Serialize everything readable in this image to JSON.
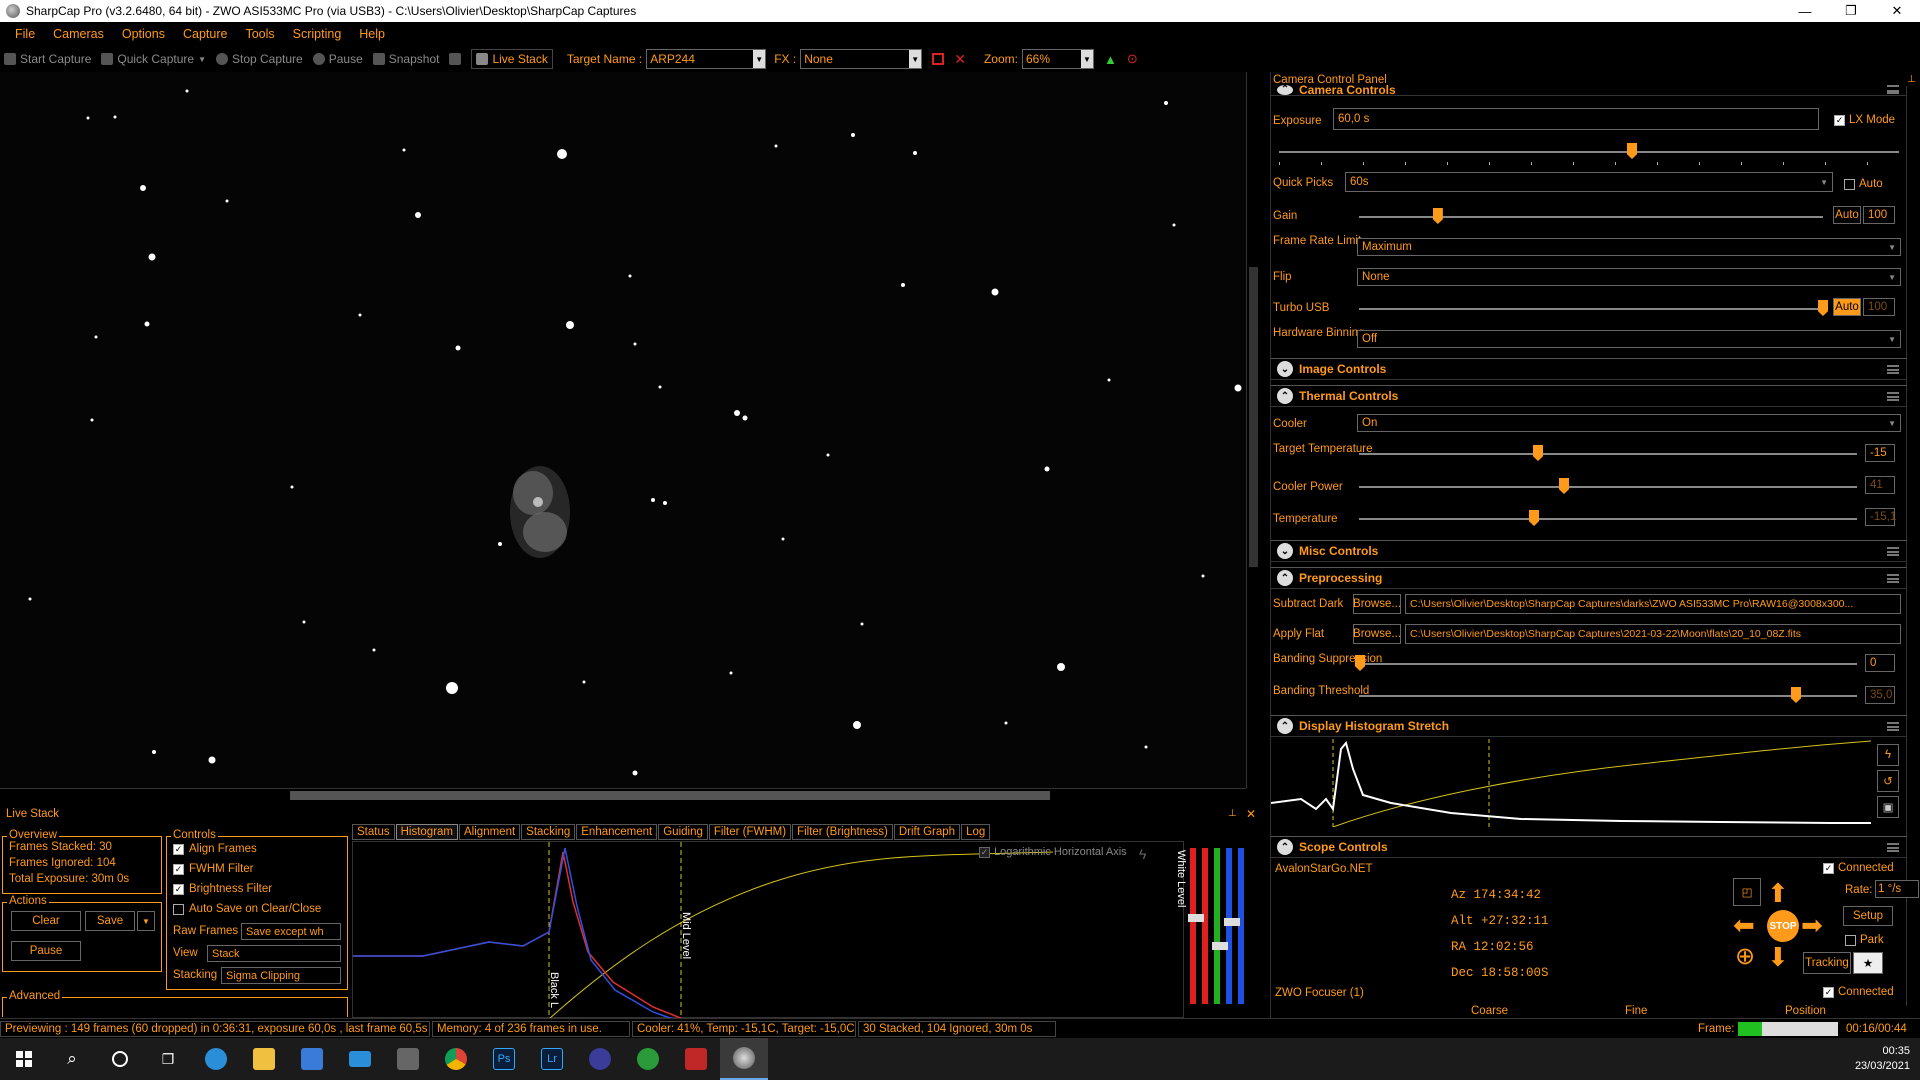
{
  "window": {
    "title": "SharpCap Pro (v3.2.6480, 64 bit) - ZWO ASI533MC Pro (via USB3) - C:\\Users\\Olivier\\Desktop\\SharpCap Captures",
    "minimize": "—",
    "maximize": "❐",
    "close": "✕"
  },
  "menu": [
    "File",
    "Cameras",
    "Options",
    "Capture",
    "Tools",
    "Scripting",
    "Help"
  ],
  "toolbar": {
    "start_capture": "Start Capture",
    "quick_capture": "Quick Capture",
    "stop_capture": "Stop Capture",
    "pause": "Pause",
    "snapshot": "Snapshot",
    "live_stack": "Live Stack",
    "target_label": "Target Name :",
    "target_value": "ARP244",
    "fx_label": "FX :",
    "fx_value": "None",
    "zoom_label": "Zoom:",
    "zoom_value": "66%"
  },
  "ccp": {
    "title": "Camera Control Panel",
    "camera_controls": "Camera Controls",
    "exposure_label": "Exposure",
    "exposure_value": "60,0 s",
    "lx_mode": "LX Mode",
    "quick_picks_label": "Quick Picks",
    "quick_picks_value": "60s",
    "auto": "Auto",
    "gain_label": "Gain",
    "gain_value": "100",
    "gain_level": 0.17,
    "frame_rate_label": "Frame Rate Limit",
    "frame_rate_value": "Maximum",
    "flip_label": "Flip",
    "flip_value": "None",
    "turbo_label": "Turbo USB",
    "turbo_value": "100",
    "turbo_level": 1.0,
    "binning_label": "Hardware Binning",
    "binning_value": "Off",
    "image_controls": "Image Controls",
    "thermal_controls": "Thermal Controls",
    "cooler_label": "Cooler",
    "cooler_value": "On",
    "target_temp_label": "Target Temperature",
    "target_temp_value": "-15",
    "cooler_power_label": "Cooler Power",
    "cooler_power_value": "41",
    "temperature_label": "Temperature",
    "temperature_value": "-15,1",
    "misc_controls": "Misc Controls",
    "preprocessing": "Preprocessing",
    "subtract_dark_label": "Subtract Dark",
    "browse": "Browse...",
    "subtract_dark_value": "C:\\Users\\Olivier\\Desktop\\SharpCap Captures\\darks\\ZWO ASI533MC Pro\\RAW16@3008x300...",
    "apply_flat_label": "Apply Flat",
    "apply_flat_value": "C:\\Users\\Olivier\\Desktop\\SharpCap Captures\\2021-03-22\\Moon\\flats\\20_10_08Z.fits",
    "banding_supp_label": "Banding Suppression",
    "banding_supp_value": "0",
    "banding_thr_label": "Banding Threshold",
    "banding_thr_value": "35,0",
    "histogram_stretch": "Display Histogram Stretch",
    "scope_controls": "Scope Controls",
    "connected": "Connected",
    "scope_name": "AvalonStarGo.NET",
    "az": "Az  174:34:42",
    "alt": "Alt +27:32:11",
    "ra": "RA  12:02:56",
    "dec": "Dec 18:58:00S",
    "rate_label": "Rate:",
    "rate_value": "1 °/s",
    "setup": "Setup",
    "park": "Park",
    "stop": "STOP",
    "tracking": "Tracking",
    "focuser_name": "ZWO Focuser (1)",
    "coarse": "Coarse",
    "fine": "Fine",
    "position": "Position"
  },
  "live_stack": {
    "title": "Live Stack",
    "overview": "Overview",
    "frames_stacked": "Frames Stacked:  30",
    "frames_ignored": "Frames Ignored:   104",
    "total_exposure": "Total Exposure:   30m 0s",
    "actions": "Actions",
    "clear": "Clear",
    "save": "Save",
    "pause": "Pause",
    "advanced": "Advanced",
    "controls": "Controls",
    "align_frames": "Align Frames",
    "fwhm_filter": "FWHM Filter",
    "brightness_filter": "Brightness Filter",
    "auto_save": "Auto Save on Clear/Close",
    "raw_frames_label": "Raw Frames",
    "raw_frames_value": "Save except wh",
    "view_label": "View",
    "view_value": "Stack",
    "stacking_label": "Stacking",
    "stacking_value": "Sigma Clipping",
    "tabs": [
      "Status",
      "Histogram",
      "Alignment",
      "Stacking",
      "Enhancement",
      "Guiding",
      "Filter (FWHM)",
      "Filter (Brightness)",
      "Drift Graph",
      "Log"
    ],
    "log_axis": "Logarithmic Horizontal Axis",
    "black_level": "Black L",
    "mid_level": "Mid Level",
    "white_level": "White Level"
  },
  "status": {
    "previewing": "Previewing : 149 frames (60 dropped) in 0:36:31, exposure 60,0s , last frame 60,5s",
    "memory": "Memory: 4 of 236 frames in use.",
    "cooler": "Cooler: 41%, Temp: -15,1C, Target: -15,0C",
    "stacked": "30 Stacked, 104 Ignored, 30m 0s",
    "frame_label": "Frame:",
    "frame_time": "00:16/00:44"
  },
  "taskbar": {
    "time": "00:35",
    "date": "23/03/2021"
  },
  "colors": {
    "accent": "#ff9a1a",
    "background": "#000000",
    "histogram_curve": "#d4c21a"
  }
}
